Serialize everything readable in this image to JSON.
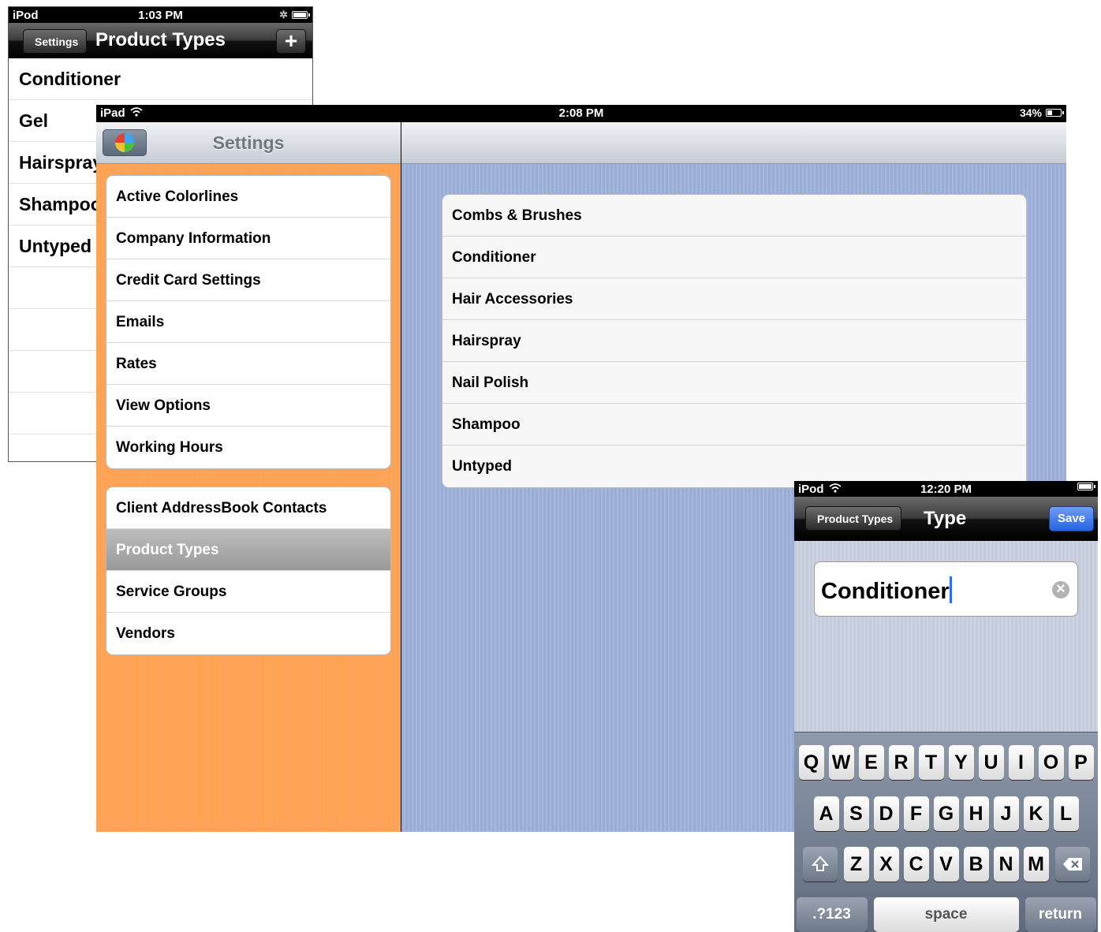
{
  "ipod_list": {
    "status": {
      "carrier": "iPod",
      "time": "1:03 PM"
    },
    "back_label": "Settings",
    "title": "Product Types",
    "add_label": "+",
    "items": [
      "Conditioner",
      "Gel",
      "Hairspray",
      "Shampoo",
      "Untyped"
    ]
  },
  "ipad": {
    "status": {
      "device": "iPad",
      "time": "2:08 PM",
      "battery": "34%"
    },
    "master_title": "Settings",
    "group1": [
      "Active Colorlines",
      "Company Information",
      "Credit Card Settings",
      "Emails",
      "Rates",
      "View Options",
      "Working Hours"
    ],
    "group2": [
      "Client AddressBook Contacts",
      "Product Types",
      "Service Groups",
      "Vendors"
    ],
    "selected_item": "Product Types",
    "detail_items": [
      "Combs & Brushes",
      "Conditioner",
      "Hair Accessories",
      "Hairspray",
      "Nail Polish",
      "Shampoo",
      "Untyped"
    ]
  },
  "ipod_edit": {
    "status": {
      "carrier": "iPod",
      "time": "12:20 PM"
    },
    "back_label": "Product Types",
    "title": "Type",
    "save_label": "Save",
    "field_value": "Conditioner",
    "keyboard": {
      "row1": [
        "Q",
        "W",
        "E",
        "R",
        "T",
        "Y",
        "U",
        "I",
        "O",
        "P"
      ],
      "row2": [
        "A",
        "S",
        "D",
        "F",
        "G",
        "H",
        "J",
        "K",
        "L"
      ],
      "row3": [
        "Z",
        "X",
        "C",
        "V",
        "B",
        "N",
        "M"
      ],
      "numbers_label": ".?123",
      "space_label": "space",
      "return_label": "return"
    }
  },
  "colors": {
    "master_bg": "#ffa251",
    "detail_bg": "#9aadd6",
    "save_button": "#2563e0",
    "selected_row": "#999999"
  },
  "icons": [
    "wifi-icon",
    "bluetooth-icon",
    "battery-icon",
    "app-logo-icon",
    "clear-text-icon",
    "shift-icon",
    "delete-icon"
  ]
}
